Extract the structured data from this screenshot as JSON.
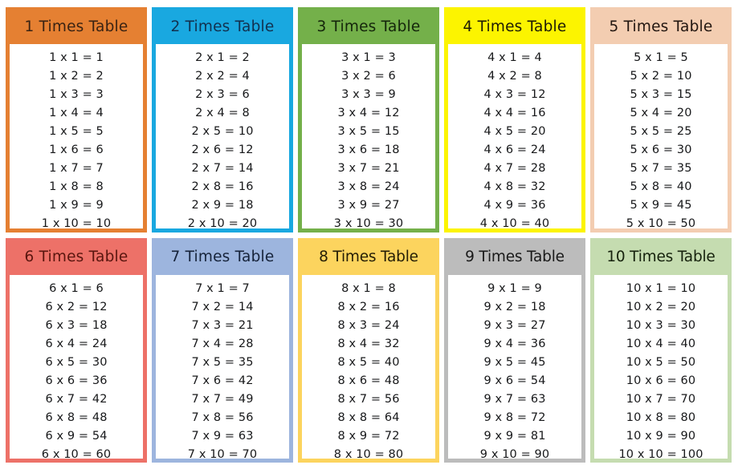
{
  "page": {
    "title": "Times Tables 1 to 10 Chart",
    "background": "#ffffff",
    "body_text_color": "#17181a",
    "columns": 5,
    "rows": 2
  },
  "symbols": {
    "multiply": "x",
    "equals": "="
  },
  "cards": [
    {
      "id": "times-table-1",
      "number": 1,
      "title": "1 Times Table",
      "header_bg": "#e58032",
      "header_text_color": "#3a2313",
      "border_color": "#e58032",
      "title_gap": "normal",
      "lines": [
        "1 x 1 = 1",
        "1 x 2 = 2",
        "1 x 3 = 3",
        "1 x 4 = 4",
        "1 x 5 = 5",
        "1 x 6 = 6",
        "1 x 7 = 7",
        "1 x 8 = 8",
        "1 x 9 = 9",
        "1 x 10 = 10"
      ]
    },
    {
      "id": "times-table-2",
      "number": 2,
      "title": "2 Times Table",
      "header_bg": "#19a8e0",
      "header_text_color": "#12314f",
      "border_color": "#19a8e0",
      "title_gap": "normal",
      "lines": [
        "2 x 1 = 2",
        "2 x 2 = 4",
        "2 x 3 = 6",
        "2 x 4 = 8",
        "2 x 5 = 10",
        "2 x 6 = 12",
        "2 x 7 = 14",
        "2 x 8 = 16",
        "2 x 9 = 18",
        "2 x 10 = 20"
      ]
    },
    {
      "id": "times-table-3",
      "number": 3,
      "title": "3 Times Table",
      "header_bg": "#74b04a",
      "header_text_color": "#14250b",
      "border_color": "#74b04a",
      "title_gap": "normal",
      "lines": [
        "3 x 1 = 3",
        "3 x 2 = 6",
        "3 x 3 = 9",
        "3 x 4 = 12",
        "3 x 5 = 15",
        "3 x 6 = 18",
        "3 x 7 = 21",
        "3 x 8 = 24",
        "3 x 9 = 27",
        "3 x 10 = 30"
      ]
    },
    {
      "id": "times-table-4",
      "number": 4,
      "title": "4 Times Table",
      "header_bg": "#fcf400",
      "header_text_color": "#1c1a05",
      "border_color": "#fcf400",
      "title_gap": "normal",
      "lines": [
        "4 x 1 = 4",
        "4 x 2 = 8",
        "4 x 3 = 12",
        "4 x 4 = 16",
        "4 x 5 = 20",
        "4 x 6 = 24",
        "4 x 7 = 28",
        "4 x 8 = 32",
        "4 x 9 = 36",
        "4 x 10 = 40"
      ]
    },
    {
      "id": "times-table-5",
      "number": 5,
      "title": "5 Times Table",
      "header_bg": "#f3cdb1",
      "header_text_color": "#221610",
      "border_color": "#f3cdb1",
      "title_gap": "normal",
      "lines": [
        "5 x 1 = 5",
        "5 x 2 = 10",
        "5 x 3 = 15",
        "5 x 4 = 20",
        "5 x 5 = 25",
        "5 x 6 = 30",
        "5 x 7 = 35",
        "5 x 8 = 40",
        "5 x 9 = 45",
        "5 x 10 = 50"
      ]
    },
    {
      "id": "times-table-6",
      "number": 6,
      "title": "6 Times Table",
      "header_bg": "#ed7168",
      "header_text_color": "#5a160f",
      "border_color": "#ed7168",
      "title_gap": "normal",
      "lines": [
        "6 x 1 = 6",
        "6 x 2 = 12",
        "6 x 3 = 18",
        "6 x 4 = 24",
        "6 x 5 = 30",
        "6 x 6 = 36",
        "6 x 7 = 42",
        "6 x 8 = 48",
        "6 x 9 = 54",
        "6 x 10 = 60"
      ]
    },
    {
      "id": "times-table-7",
      "number": 7,
      "title": "7 Times Table",
      "header_bg": "#9db5de",
      "header_text_color": "#16233a",
      "border_color": "#9db5de",
      "title_gap": "normal",
      "lines": [
        "7 x 1 = 7",
        "7 x 2 = 14",
        "7 x 3 = 21",
        "7 x 4 = 28",
        "7 x 5 = 35",
        "7 x 6 = 42",
        "7 x 7 = 49",
        "7 x 8 = 56",
        "7 x 9 = 63",
        "7 x 10 = 70"
      ]
    },
    {
      "id": "times-table-8",
      "number": 8,
      "title": "8 Times Table",
      "header_bg": "#fcd45e",
      "header_text_color": "#241d06",
      "border_color": "#fcd45e",
      "title_gap": "tight",
      "lines": [
        "8 x 1 = 8",
        "8 x 2 = 16",
        "8 x 3 = 24",
        "8 x 4 = 32",
        "8 x 5 = 40",
        "8 x 6 = 48",
        "8 x 7 = 56",
        "8 x 8 = 64",
        "8 x 9 = 72",
        "8 x 10 = 80"
      ]
    },
    {
      "id": "times-table-9",
      "number": 9,
      "title": "9 Times Table",
      "header_bg": "#bcbcbc",
      "header_text_color": "#1a1a1a",
      "border_color": "#bcbcbc",
      "title_gap": "tight",
      "lines": [
        "9 x 1 = 9",
        "9 x 2 = 18",
        "9 x 3 = 27",
        "9 x 4 = 36",
        "9 x 5 = 45",
        "9 x 6 = 54",
        "9 x 7 = 63",
        "9 x 8 = 72",
        "9 x 9 = 81",
        "9 x 10 = 90"
      ]
    },
    {
      "id": "times-table-10",
      "number": 10,
      "title": "10 Times Table",
      "header_bg": "#c5dcb0",
      "header_text_color": "#16220d",
      "border_color": "#c5dcb0",
      "title_gap": "tight",
      "lines": [
        "10 x 1 = 10",
        "10 x 2 = 20",
        "10 x 3 = 30",
        "10 x 4 = 40",
        "10 x 5 = 50",
        "10 x 6 = 60",
        "10 x 7 = 70",
        "10 x 8 = 80",
        "10 x 9 = 90",
        "10 x 10 = 100"
      ]
    }
  ]
}
